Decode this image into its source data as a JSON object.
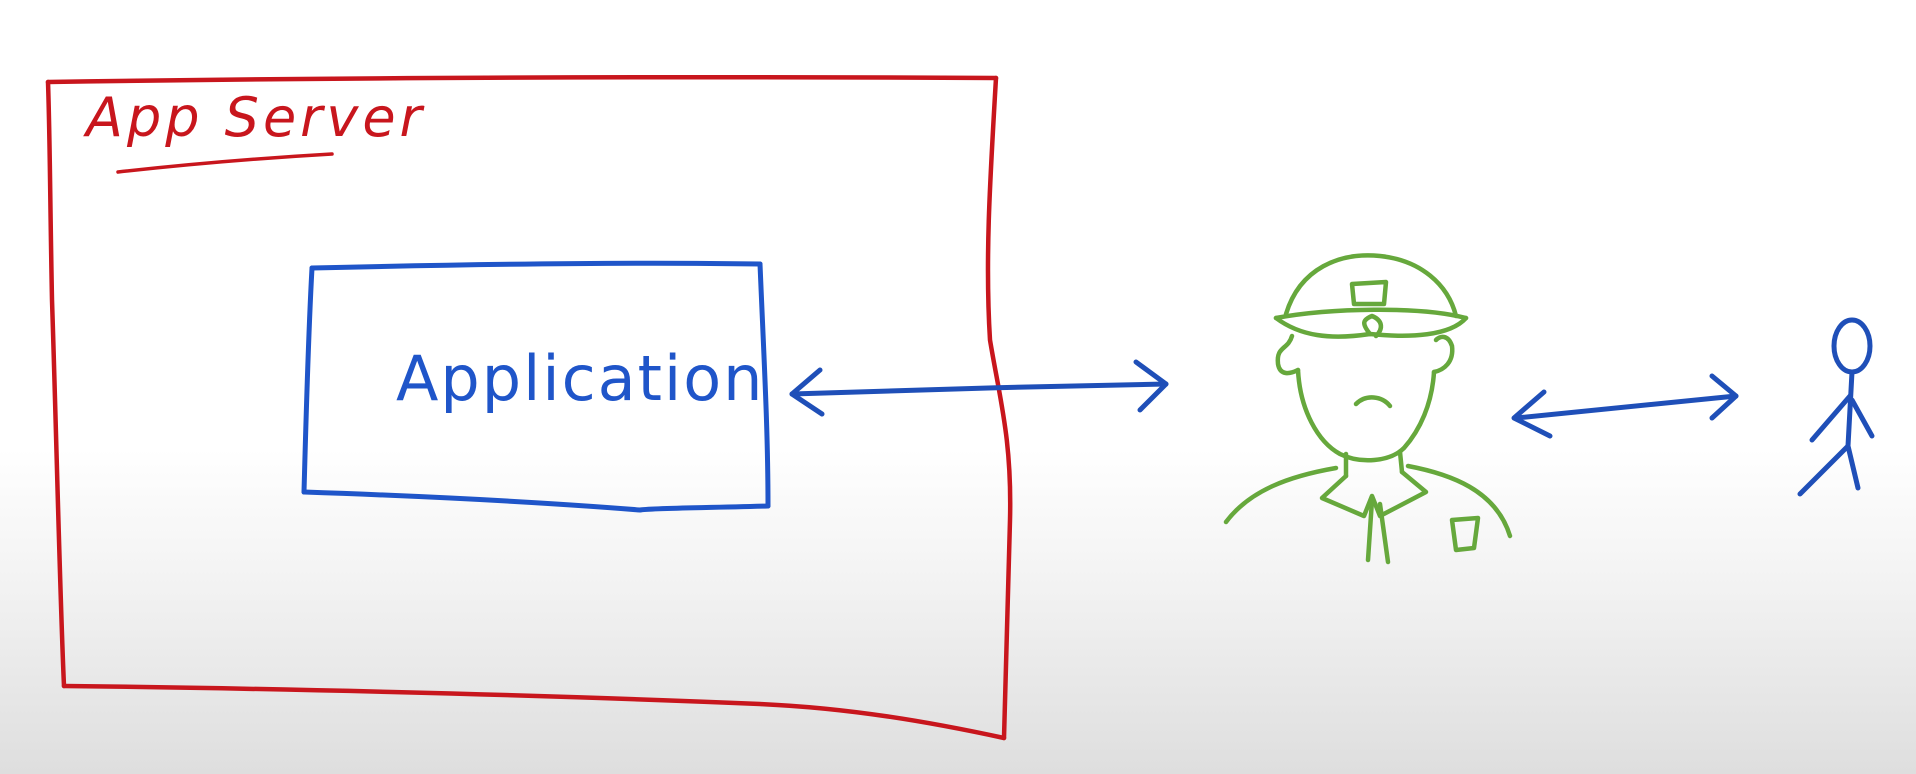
{
  "labels": {
    "app_server": "App Server",
    "application": "Application"
  },
  "colors": {
    "app_server": "#c8161d",
    "application": "#1f55c9",
    "arrow": "#1f4fb8",
    "guard": "#66a83c",
    "user": "#1f4fb8"
  },
  "icons": {
    "guard": "security-guard-icon",
    "user": "stick-figure-user-icon"
  }
}
